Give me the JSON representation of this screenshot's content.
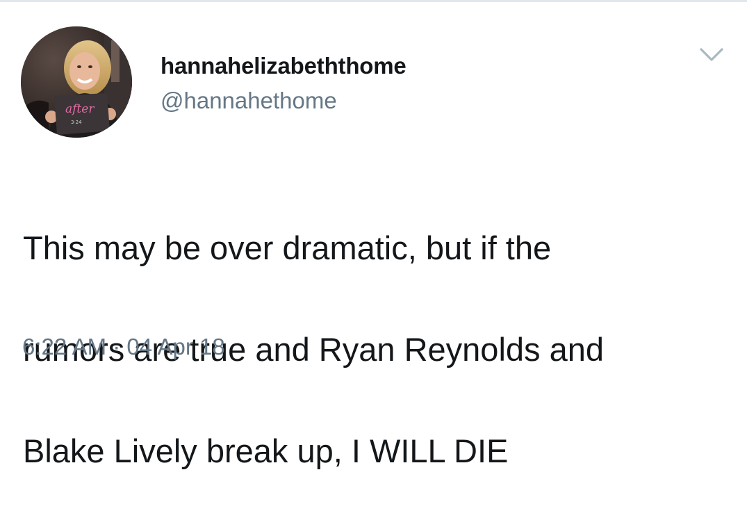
{
  "tweet": {
    "author": {
      "display_name": "hannahelizabeththome",
      "handle": "@hannahethome",
      "avatar_sign_text": "after"
    },
    "text_lines": [
      "This may be over dramatic, but if the",
      "rumors are true and Ryan Reynolds and",
      "Blake Lively break up, I WILL DIE"
    ],
    "timestamp": "6:22 AM · 04 Apr 18",
    "menu_icon": "chevron-down-icon"
  },
  "colors": {
    "text_primary": "#14171a",
    "text_secondary": "#657786",
    "chevron": "#aab8c2",
    "divider": "#e1e8ed"
  }
}
